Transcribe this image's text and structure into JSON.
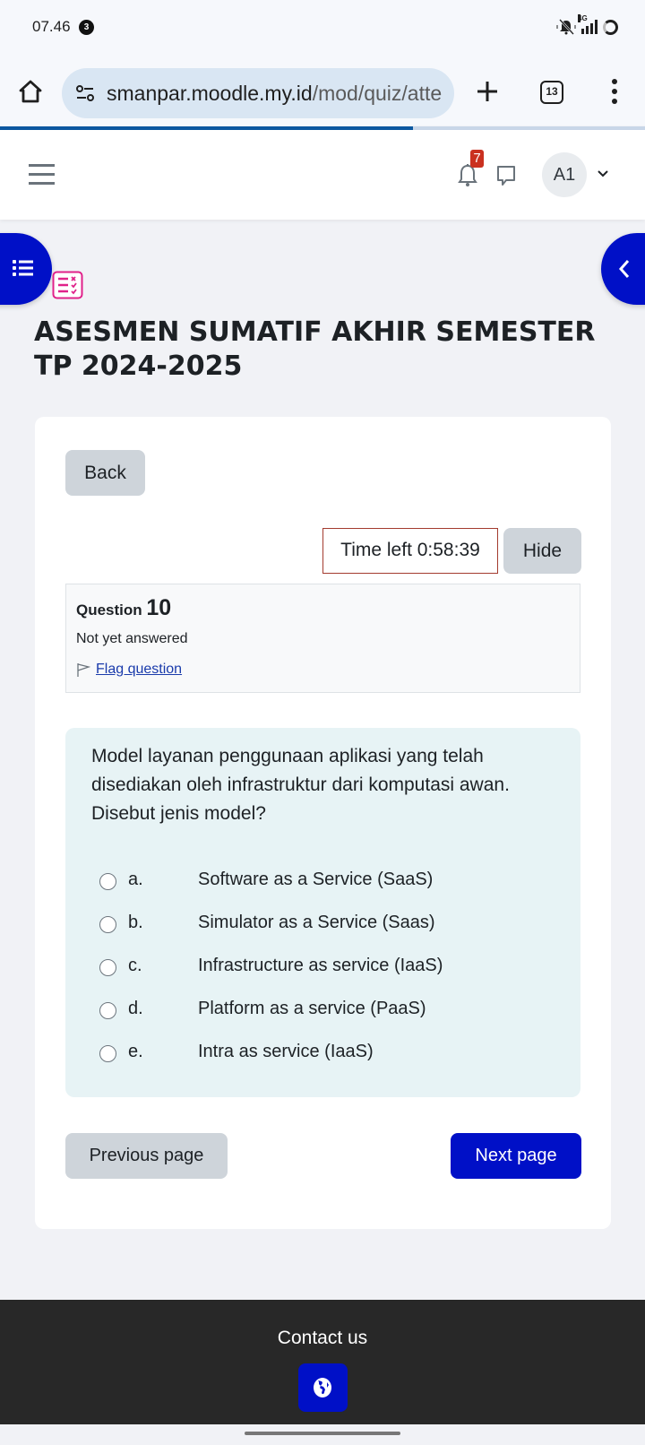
{
  "status_bar": {
    "time": "07.46",
    "notification_count": "3",
    "network": "4G"
  },
  "browser": {
    "url_host": "smanpar.moodle.my.id",
    "url_path": "/mod/quiz/atte",
    "tab_count": "13",
    "load_progress_percent": 64
  },
  "navbar": {
    "notification_badge": "7",
    "avatar_initials": "A1"
  },
  "page": {
    "title": "ASESMEN SUMATIF AKHIR SEMESTER TP 2024-2025"
  },
  "quiz": {
    "back_label": "Back",
    "timer_text": "Time left 0:58:39",
    "hide_label": "Hide",
    "question_label": "Question",
    "question_number": "10",
    "question_state": "Not yet answered",
    "flag_label": "Flag question",
    "question_text": "Model layanan penggunaan aplikasi yang telah disediakan oleh infrastruktur dari komputasi awan. Disebut jenis model?",
    "answers": [
      {
        "letter": "a.",
        "text": "Software as a Service (SaaS)",
        "selected": false
      },
      {
        "letter": "b.",
        "text": "Simulator as a Service (Saas)",
        "selected": false
      },
      {
        "letter": "c.",
        "text": "Infrastructure as service (IaaS)",
        "selected": false
      },
      {
        "letter": "d.",
        "text": "Platform as a service (PaaS)",
        "selected": false
      },
      {
        "letter": "e.",
        "text": "Intra as service (IaaS)",
        "selected": false
      }
    ],
    "prev_label": "Previous page",
    "next_label": "Next page"
  },
  "footer": {
    "contact_label": "Contact us"
  },
  "colors": {
    "primary": "#0010c7",
    "badge": "#ca3120",
    "timer_border": "#a33b2f",
    "question_bg": "#e7f3f5",
    "footer_bg": "#282828",
    "quiz_icon": "#e0218a"
  }
}
